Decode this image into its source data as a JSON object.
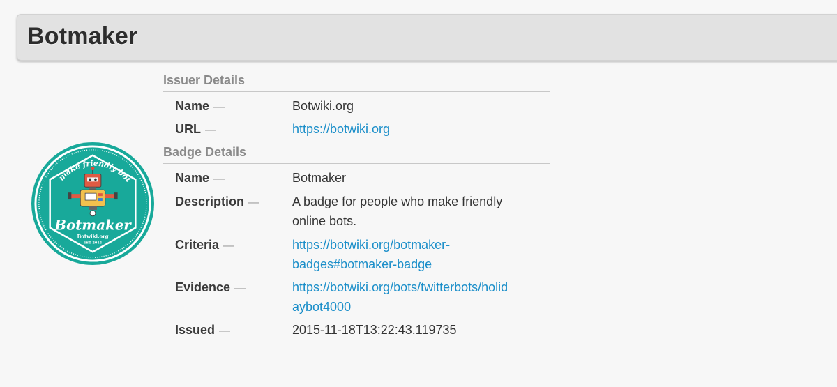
{
  "header": {
    "title": "Botmaker"
  },
  "badge_image": {
    "arc_text": "I make friendly bots",
    "name": "Botmaker",
    "site": "Botwiki.org",
    "est": "EST 2015",
    "colors": {
      "bg": "#18a99a",
      "ring": "#ffffff"
    }
  },
  "issuer": {
    "section_title": "Issuer Details",
    "name_label": "Name",
    "name_value": "Botwiki.org",
    "url_label": "URL",
    "url_value": "https://botwiki.org"
  },
  "badge": {
    "section_title": "Badge Details",
    "name_label": "Name",
    "name_value": "Botmaker",
    "description_label": "Description",
    "description_line1": "A badge for people who make friendly",
    "description_line2": "online bots.",
    "criteria_label": "Criteria",
    "criteria_line1": "https://botwiki.org/botmaker-",
    "criteria_line2": "badges#botmaker-badge",
    "evidence_label": "Evidence",
    "evidence_line1": "https://botwiki.org/bots/twitterbots/holid",
    "evidence_line2": "aybot4000",
    "issued_label": "Issued",
    "issued_value": "2015-11-18T13:22:43.119735"
  },
  "separator": "—",
  "link_color": "#1a8ec9"
}
